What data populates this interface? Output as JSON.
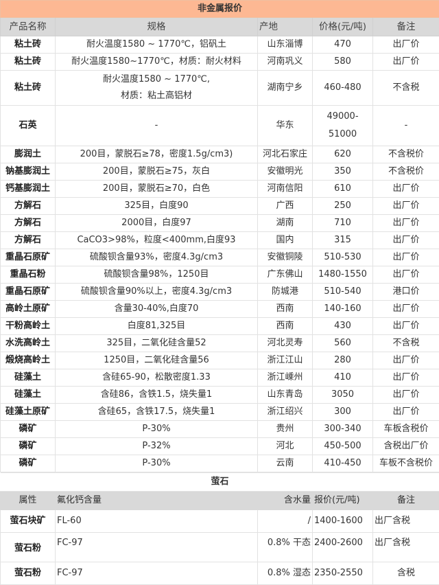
{
  "nonmetal": {
    "title": "非金属报价",
    "headers": [
      "产品名称",
      "规格",
      "产地",
      "价格(元/吨)",
      "备注"
    ],
    "rows": [
      {
        "name": "粘土砖",
        "spec": "耐火温度1580 ~ 1770℃，铝矾土",
        "origin": "山东淄博",
        "price": "470",
        "note": "出厂价"
      },
      {
        "name": "粘土砖",
        "spec": "耐火温度1580~1770℃，材质：耐火材料",
        "origin": "河南巩义",
        "price": "580",
        "note": "出厂价"
      },
      {
        "name": "粘土砖",
        "spec_line1": "耐火温度1580 ~ 1770℃,",
        "spec_line2": "材质：粘土高铝材",
        "origin": "湖南宁乡",
        "price": "460-480",
        "note": "不含税"
      },
      {
        "name": "石英",
        "spec": "-",
        "origin": "华东",
        "price_line1": "49000-",
        "price_line2": "51000",
        "note": "-"
      },
      {
        "name": "膨润土",
        "spec": "200目，蒙脱石≥78，密度1.5g/cm3)",
        "origin": "河北石家庄",
        "price": "620",
        "note": "不含税价"
      },
      {
        "name": "钠基膨润土",
        "spec": "200目，蒙脱石≥75，灰白",
        "origin": "安徽明光",
        "price": "350",
        "note": "不含税价"
      },
      {
        "name": "钙基膨润土",
        "spec": "200目，蒙脱石≥70，白色",
        "origin": "河南信阳",
        "price": "610",
        "note": "出厂价"
      },
      {
        "name": "方解石",
        "spec": "325目，白度90",
        "origin": "广西",
        "price": "250",
        "note": "出厂价"
      },
      {
        "name": "方解石",
        "spec": "2000目，白度97",
        "origin": "湖南",
        "price": "710",
        "note": "出厂价"
      },
      {
        "name": "方解石",
        "spec": "CaCO3>98%，粒度<400mm,白度93",
        "origin": "国内",
        "price": "315",
        "note": "出厂价"
      },
      {
        "name": "重晶石原矿",
        "spec": "硫酸钡含量93%，密度4.3g/cm3",
        "origin": "安徽铜陵",
        "price": "510-530",
        "note": "出厂价"
      },
      {
        "name": "重晶石粉",
        "spec": "硫酸钡含量98%，1250目",
        "origin": "广东佛山",
        "price": "1480-1550",
        "note": "出厂价"
      },
      {
        "name": "重晶石原矿",
        "spec": "硫酸钡含量90%以上，密度4.3g/cm3",
        "origin": "防城港",
        "price": "510-540",
        "note": "港口价"
      },
      {
        "name": "高岭土原矿",
        "spec": "含量30-40%,白度70",
        "origin": "西南",
        "price": "140-160",
        "note": "出厂价"
      },
      {
        "name": "干粉高岭土",
        "spec": "白度81,325目",
        "origin": "西南",
        "price": "430",
        "note": "出厂价"
      },
      {
        "name": "水洗高岭土",
        "spec": "325目，二氧化硅含量52",
        "origin": "河北灵寿",
        "price": "560",
        "note": "不含税"
      },
      {
        "name": "煅烧高岭土",
        "spec": "1250目，二氧化硅含量56",
        "origin": "浙江江山",
        "price": "280",
        "note": "出厂价"
      },
      {
        "name": "硅藻土",
        "spec": "含硅65-90，松散密度1.33",
        "origin": "浙江嵊州",
        "price": "410",
        "note": "出厂价"
      },
      {
        "name": "硅藻土",
        "spec": "含硅86，含铁1.5，烧失量1",
        "origin": "山东青岛",
        "price": "3050",
        "note": "出厂价"
      },
      {
        "name": "硅藻土原矿",
        "spec": "含硅65，含铁17.5，烧失量1",
        "origin": "浙江绍兴",
        "price": "300",
        "note": "出厂价"
      },
      {
        "name": "磷矿",
        "spec": "P-30%",
        "origin": "贵州",
        "price": "300-340",
        "note": "车板含税价"
      },
      {
        "name": "磷矿",
        "spec": "P-32%",
        "origin": "河北",
        "price": "450-500",
        "note": "含税出厂价"
      },
      {
        "name": "磷矿",
        "spec": "P-30%",
        "origin": "云南",
        "price": "410-450",
        "note": "车板不含税价"
      }
    ]
  },
  "fluorite": {
    "title": "萤石",
    "headers": [
      "属性",
      "氟化钙含量",
      "含水量",
      "报价(元/吨)",
      "备注"
    ],
    "rows": [
      {
        "name": "萤石块矿",
        "caf2": "FL-60",
        "water": "/",
        "price": "1400-1600",
        "note": "出厂含税"
      },
      {
        "name": "萤石粉",
        "caf2": "FC-97",
        "water": "0.8% 干态",
        "price": "2400-2600",
        "note": "出厂含税"
      },
      {
        "name": "萤石粉",
        "caf2": "FC-97",
        "water": "0.8% 湿态",
        "price": "2350-2550",
        "note": "含税"
      }
    ]
  }
}
